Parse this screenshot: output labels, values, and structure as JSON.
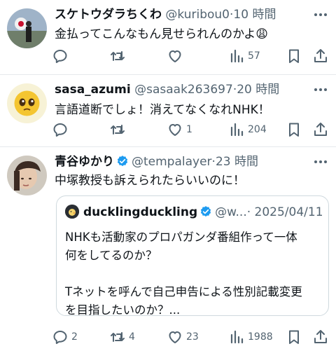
{
  "posts": [
    {
      "name": "スケトウダラちくわ",
      "handle": "@kuribou0",
      "sep": "·",
      "time": "10 時間",
      "text": "金払ってこんなもん見せられんのかよ😩",
      "replies": "",
      "reposts": "",
      "likes": "",
      "views": "57"
    },
    {
      "name": "sasa_azumi",
      "handle": "@sasaak263697",
      "sep": "·",
      "time": "20 時間",
      "text": "言語道断でしょ！消えてなくなれNHK！",
      "replies": "",
      "reposts": "",
      "likes": "1",
      "views": "204"
    },
    {
      "name": "青谷ゆかり",
      "handle": "@tempalayer",
      "sep": "·",
      "time": "23 時間",
      "text": "中塚教授も訴えられたらいいのに！",
      "replies": "2",
      "reposts": "4",
      "likes": "23",
      "views": "1988",
      "quote": {
        "name": "ducklingduckling",
        "handle": "@w...",
        "sep": "·",
        "date": "2025/04/11",
        "text": "NHKも活動家のプロパガンダ番組作って一体\n何をしてるのか？\n\nTネットを呼んで自己申告による性別記載変更\nを目指したいのか？..."
      }
    }
  ],
  "colors": {
    "muted": "#536471",
    "verified": "#1d9bf0",
    "divider": "#e6e9ec"
  }
}
